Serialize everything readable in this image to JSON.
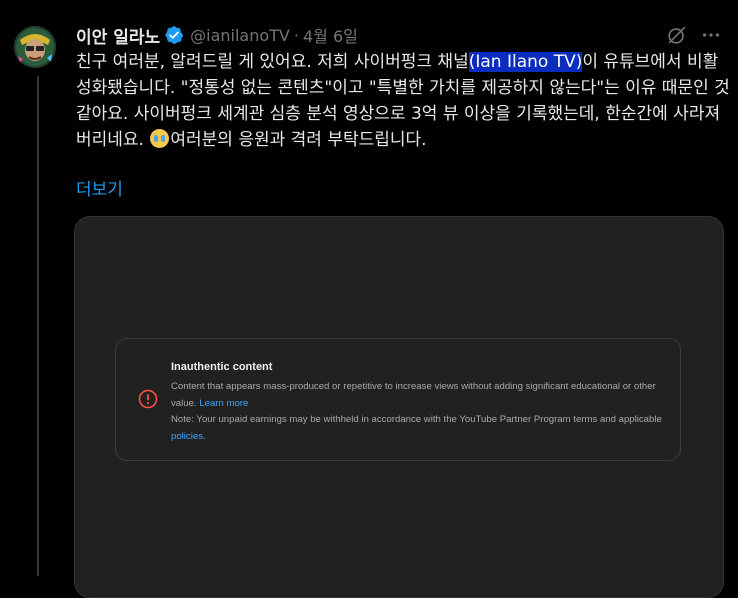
{
  "author": {
    "name": "이안 일라노",
    "handle": "@ianilanoTV",
    "separator": "·",
    "date": "4월 6일"
  },
  "tweet": {
    "text_part1": "친구 여러분, 알려드릴 게 있어요. 저희 사이버펑크 채널",
    "highlight": "(Ian Ilano TV)",
    "text_part2": "이 유튜브에서 비활성화됐습니다. \"정통성 없는 콘텐츠\"이고 \"특별한 가치를 제공하지 않는다\"는 이유 때문인 것 같아요. 사이버펑크 세계관 심층 분석 영상으로 3억 뷰 이상을 기록했는데, 한순간에 사라져 버리네요.",
    "emoji": "loudly-crying-face",
    "text_part3": "여러분의 응원과 격려 부탁드립니다.",
    "show_more": "더보기"
  },
  "notice": {
    "title": "Inauthentic content",
    "body1": "Content that appears mass-produced or repetitive to increase views without adding significant educational or other value.",
    "learn_more": "Learn more",
    "body2": "Note: Your unpaid earnings may be withheld in accordance with the YouTube Partner Program terms and applicable",
    "policies": "policies",
    "period": "."
  },
  "colors": {
    "accent": "#1d9bf0",
    "warning": "#ff4e45",
    "highlight_bg": "#0a2dbf"
  }
}
